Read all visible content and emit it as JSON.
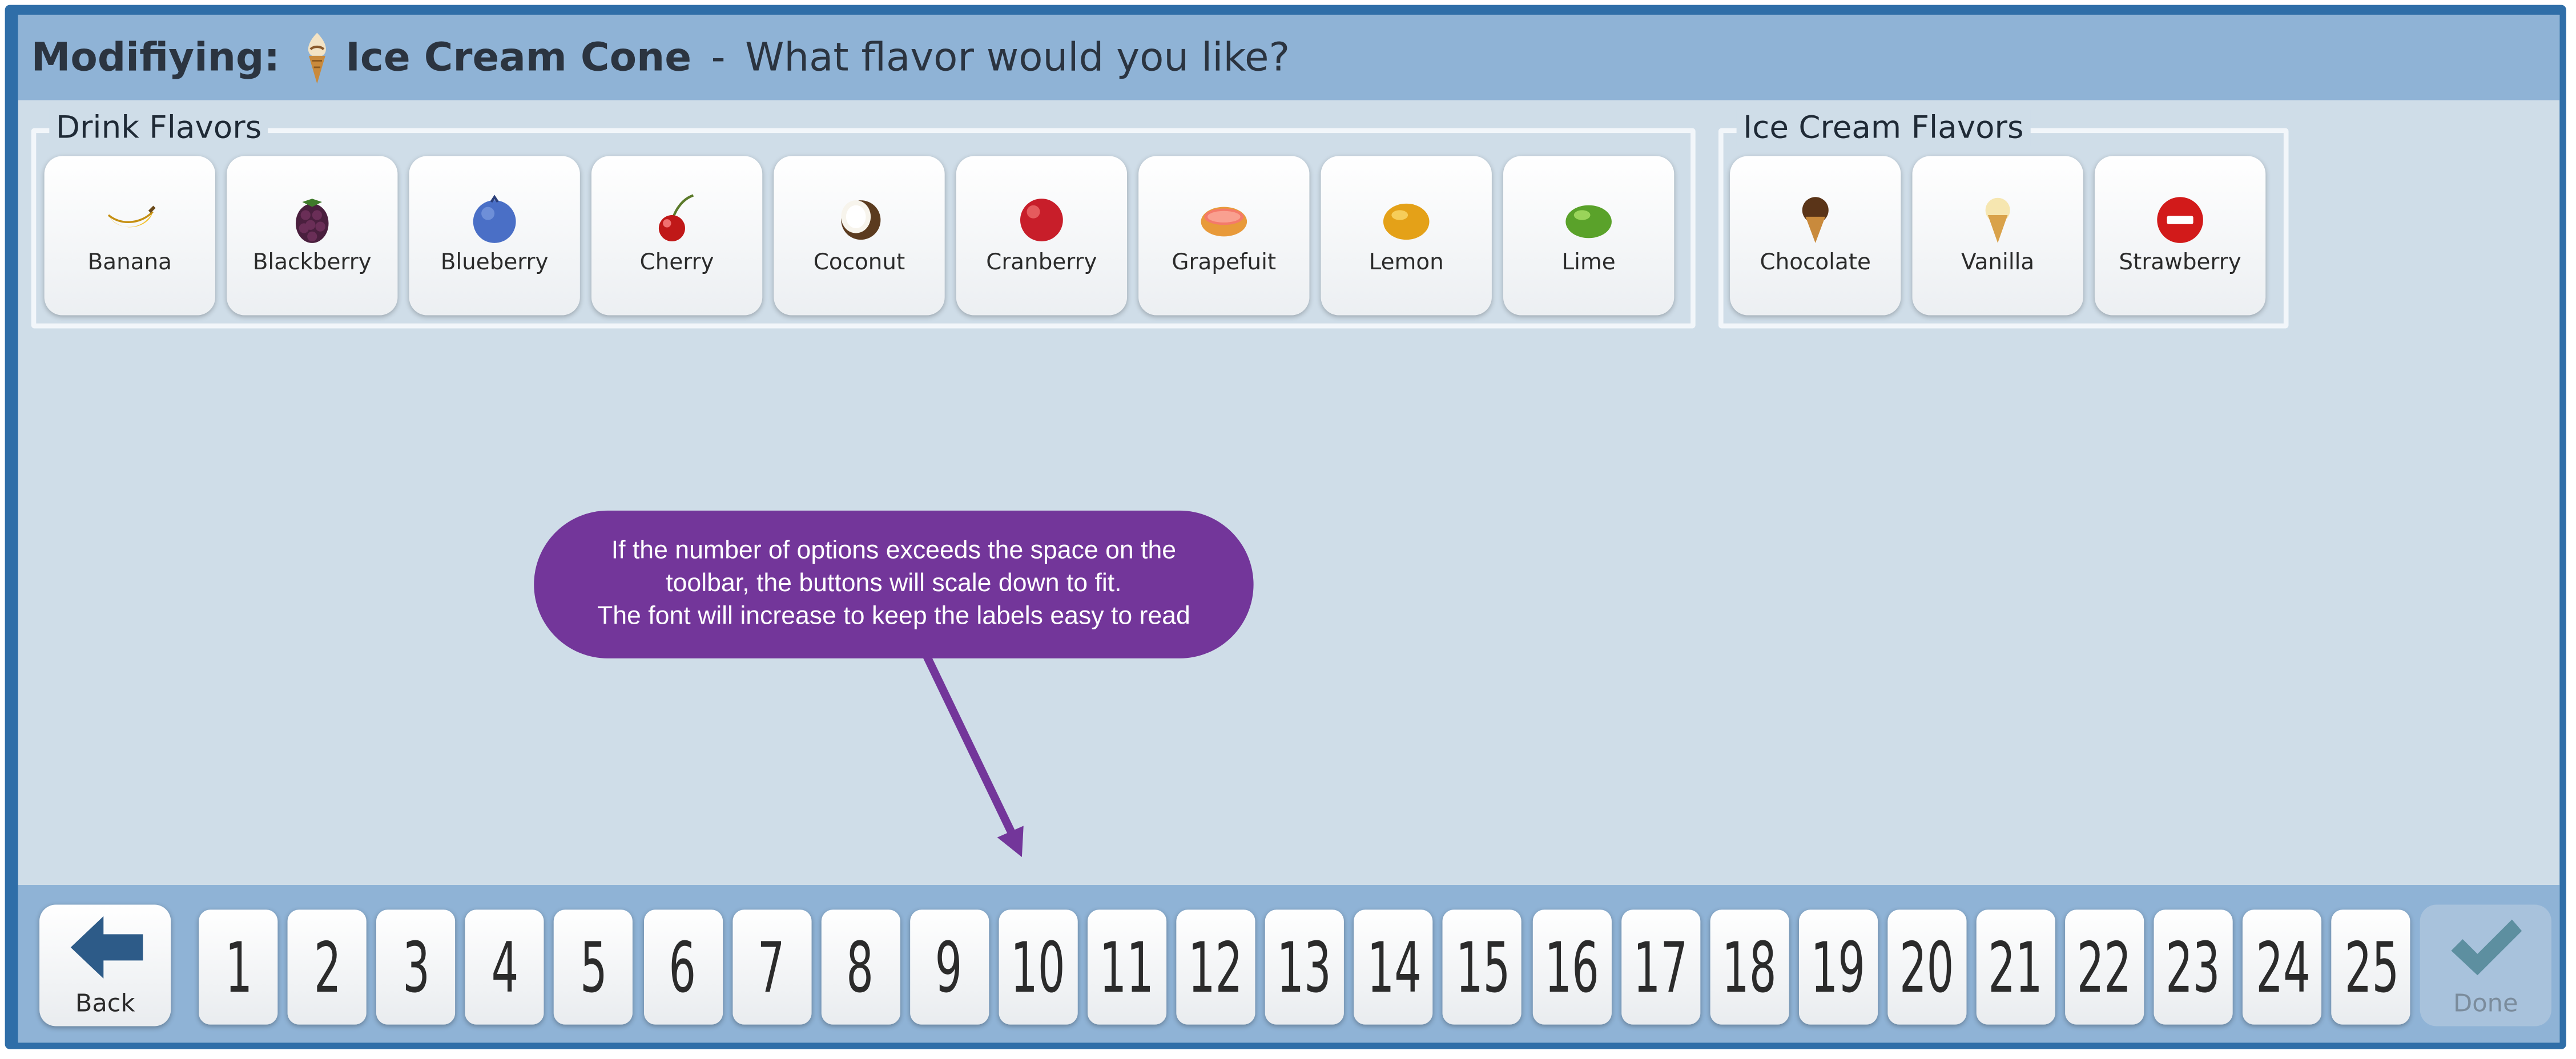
{
  "title": {
    "prefix": "Modifiying:",
    "item": "Ice Cream Cone",
    "separator": "-",
    "question": "What flavor would you like?"
  },
  "groups": [
    {
      "legend": "Drink Flavors",
      "items": [
        {
          "label": "Banana",
          "icon": "banana-icon"
        },
        {
          "label": "Blackberry",
          "icon": "blackberry-icon"
        },
        {
          "label": "Blueberry",
          "icon": "blueberry-icon"
        },
        {
          "label": "Cherry",
          "icon": "cherry-icon"
        },
        {
          "label": "Coconut",
          "icon": "coconut-icon"
        },
        {
          "label": "Cranberry",
          "icon": "cranberry-icon"
        },
        {
          "label": "Grapefuit",
          "icon": "grapefruit-icon"
        },
        {
          "label": "Lemon",
          "icon": "lemon-icon"
        },
        {
          "label": "Lime",
          "icon": "lime-icon"
        }
      ]
    },
    {
      "legend": "Ice Cream Flavors",
      "items": [
        {
          "label": "Chocolate",
          "icon": "chocolate-cone-icon"
        },
        {
          "label": "Vanilla",
          "icon": "vanilla-cone-icon"
        },
        {
          "label": "Strawberry",
          "icon": "no-entry-icon"
        }
      ]
    }
  ],
  "callout": {
    "line1": "If the number of options exceeds the space on the",
    "line2": "toolbar, the buttons will scale down to fit.",
    "line3": "The font will increase to keep the labels easy to read"
  },
  "toolbar": {
    "back_label": "Back",
    "done_label": "Done",
    "numbers": [
      "1",
      "2",
      "3",
      "4",
      "5",
      "6",
      "7",
      "8",
      "9",
      "10",
      "11",
      "12",
      "13",
      "14",
      "15",
      "16",
      "17",
      "18",
      "19",
      "20",
      "21",
      "22",
      "23",
      "24",
      "25"
    ]
  },
  "colors": {
    "title_bar": "#8fb3d6",
    "background": "#cfdde8",
    "frame": "#2f6ea8",
    "callout": "#73369a",
    "back_arrow": "#2d5b88",
    "done_check": "#5d8fa0"
  }
}
